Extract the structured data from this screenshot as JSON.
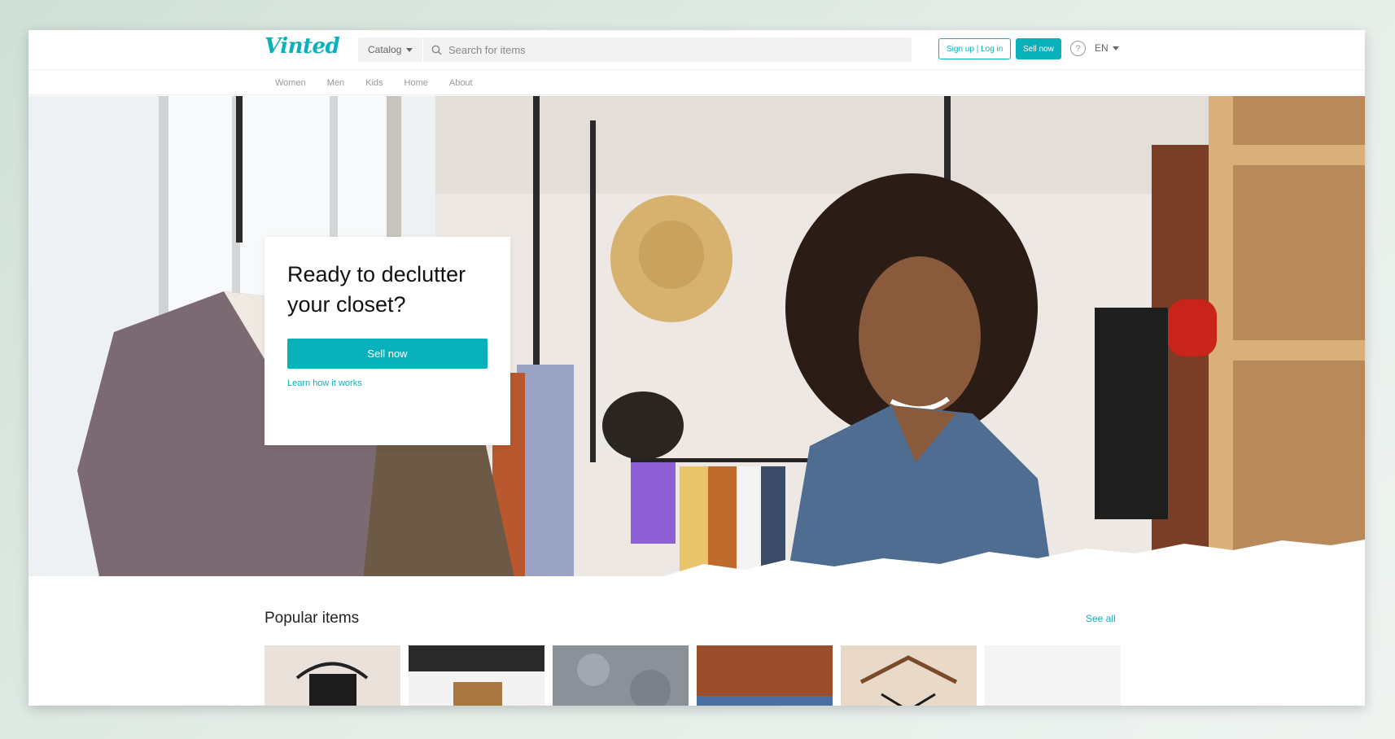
{
  "brand": {
    "logo_text": "Vinted",
    "accent_color": "#09b1ba"
  },
  "header": {
    "catalog_label": "Catalog",
    "search_placeholder": "Search for items",
    "signup_label": "Sign up | Log in",
    "sell_now_label": "Sell now",
    "help_icon": "question-circle-icon",
    "language": "EN"
  },
  "nav": {
    "items": [
      {
        "label": "Women"
      },
      {
        "label": "Men"
      },
      {
        "label": "Kids"
      },
      {
        "label": "Home"
      },
      {
        "label": "About"
      }
    ]
  },
  "hero": {
    "title": "Ready to declutter your closet?",
    "sell_button_label": "Sell now",
    "learn_link_label": "Learn how it works"
  },
  "popular": {
    "title": "Popular items",
    "see_all_label": "See all",
    "items": [
      {
        "name": "black lace top on hanger"
      },
      {
        "name": "tan jacket"
      },
      {
        "name": "grey knit"
      },
      {
        "name": "brown fur and denim"
      },
      {
        "name": "strappy top on wooden hanger"
      },
      {
        "name": "placeholder item"
      }
    ]
  }
}
